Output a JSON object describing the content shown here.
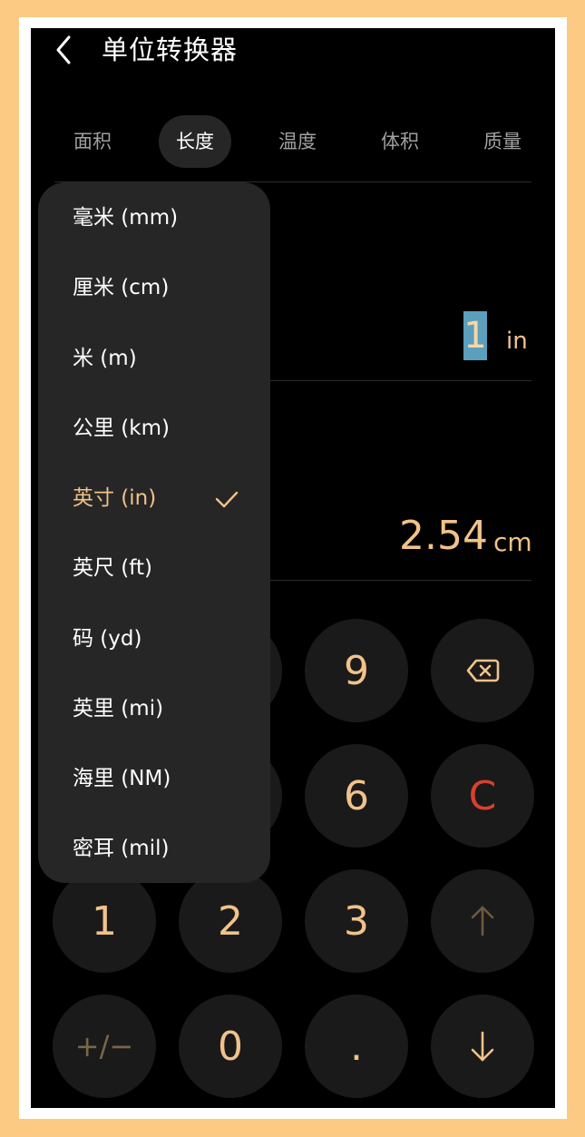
{
  "header": {
    "title": "单位转换器",
    "back_icon": "chevron-left-icon"
  },
  "tabs": [
    {
      "label": "面积",
      "active": false
    },
    {
      "label": "长度",
      "active": true
    },
    {
      "label": "温度",
      "active": false
    },
    {
      "label": "体积",
      "active": false
    },
    {
      "label": "质量",
      "active": false
    }
  ],
  "input": {
    "value": "1",
    "unit": "in"
  },
  "result": {
    "value": "2.54",
    "unit": "cm"
  },
  "dropdown": {
    "items": [
      {
        "label": "毫米 (mm)",
        "selected": false
      },
      {
        "label": "厘米 (cm)",
        "selected": false
      },
      {
        "label": "米 (m)",
        "selected": false
      },
      {
        "label": "公里 (km)",
        "selected": false
      },
      {
        "label": "英寸 (in)",
        "selected": true
      },
      {
        "label": "英尺 (ft)",
        "selected": false
      },
      {
        "label": "码 (yd)",
        "selected": false
      },
      {
        "label": "英里 (mi)",
        "selected": false
      },
      {
        "label": "海里 (NM)",
        "selected": false
      },
      {
        "label": "密耳 (mil)",
        "selected": false
      }
    ],
    "check_icon": "checkmark-icon"
  },
  "keypad": {
    "nine": "9",
    "six": "6",
    "clear": "C",
    "one": "1",
    "two": "2",
    "three": "3",
    "plus_minus": "+/−",
    "zero": "0",
    "dot": ".",
    "backspace_icon": "backspace-icon",
    "up_icon": "arrow-up-icon",
    "down_icon": "arrow-down-icon"
  },
  "colors": {
    "accent": "#f1c28a",
    "background": "#000000",
    "key_background": "#1a1a1a",
    "dropdown_background": "#262626",
    "clear": "#d8402e",
    "selection_highlight": "#5b9fbd"
  }
}
